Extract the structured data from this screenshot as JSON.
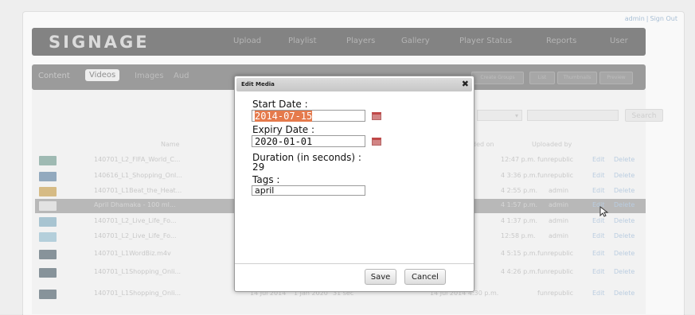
{
  "topbar": {
    "user": "admin",
    "separator": "|",
    "signout": "Sign Out"
  },
  "header": {
    "logo": "SIGNAGE",
    "nav": [
      "Upload",
      "Playlist",
      "Players",
      "Gallery",
      "Player Status",
      "Reports",
      "User"
    ]
  },
  "subnav": {
    "section": "Content",
    "tabs": [
      "Videos",
      "Images",
      "Aud"
    ],
    "right_buttons": [
      "Create Groups",
      "List",
      "Thumbnails",
      "Preview"
    ]
  },
  "filter": {
    "select_value": "",
    "search_label": "Search"
  },
  "table": {
    "headers": [
      "Name",
      "ded on",
      "Uploaded by"
    ],
    "rows": [
      {
        "name": "140701_L2_FIFA_World_C...",
        "uploaded_on": "12:47 p.m.",
        "by": "funrepublic",
        "edit": "Edit",
        "delete": "Delete",
        "thumb": "#7fa39a"
      },
      {
        "name": "140616_L1_Shopping_Onl...",
        "uploaded_on": "4 3:36 p.m.",
        "by": "funrepublic",
        "edit": "Edit",
        "delete": "Delete",
        "thumb": "#6e8ca8"
      },
      {
        "name": "140701_L1Beat_the_Heat...",
        "uploaded_on": "4 2:55 p.m.",
        "by": "admin",
        "edit": "Edit",
        "delete": "Delete",
        "thumb": "#c9a55c"
      },
      {
        "name": "April Dhamaka - 100 ml...",
        "uploaded_on": "4 1:57 p.m.",
        "by": "admin",
        "edit": "Edit",
        "delete": "Delete",
        "thumb": "#d8d8d8"
      },
      {
        "name": "140701_L2_Live_Life_Fo...",
        "uploaded_on": "4 1:37 p.m.",
        "by": "admin",
        "edit": "Edit",
        "delete": "Delete",
        "thumb": "#8bb0c2"
      },
      {
        "name": "140701_L2_Live_Life_Fo...",
        "uploaded_on": "12:58 p.m.",
        "by": "admin",
        "edit": "Edit",
        "delete": "Delete",
        "thumb": "#9bbfcf"
      },
      {
        "name": "140701_L1WordBiz.m4v",
        "uploaded_on": "4 5:15 p.m.",
        "by": "funrepublic",
        "edit": "Edit",
        "delete": "Delete",
        "thumb": "#5f6f78"
      },
      {
        "name": "140701_L1Shopping_Onli...",
        "uploaded_on": "4 4:26 p.m.",
        "by": "funrepublic",
        "edit": "Edit",
        "delete": "Delete",
        "thumb": "#5f6f78"
      },
      {
        "name": "140701_L1Shopping_Onli...",
        "start": "14 Jul 2014",
        "end": "1 Jan 2020",
        "duration": "31 sec",
        "uploaded_on": "14 Jul 2014 4:30 p.m.",
        "by": "funrepublic",
        "edit": "Edit",
        "delete": "Delete",
        "thumb": "#5f6f78"
      }
    ]
  },
  "modal": {
    "title": "Edit Media",
    "close": "✖",
    "start_label": "Start Date :",
    "start_value": "2014-07-15",
    "expiry_label": "Expiry Date :",
    "expiry_value": "2020-01-01",
    "duration_label": "Duration (in seconds) :",
    "duration_value": "29",
    "tags_label": "Tags :",
    "tags_value": "april",
    "save": "Save",
    "cancel": "Cancel"
  },
  "colors": {
    "header": "#5a5a5a",
    "selection": "#e57a4c",
    "link": "#a3bcd6"
  }
}
